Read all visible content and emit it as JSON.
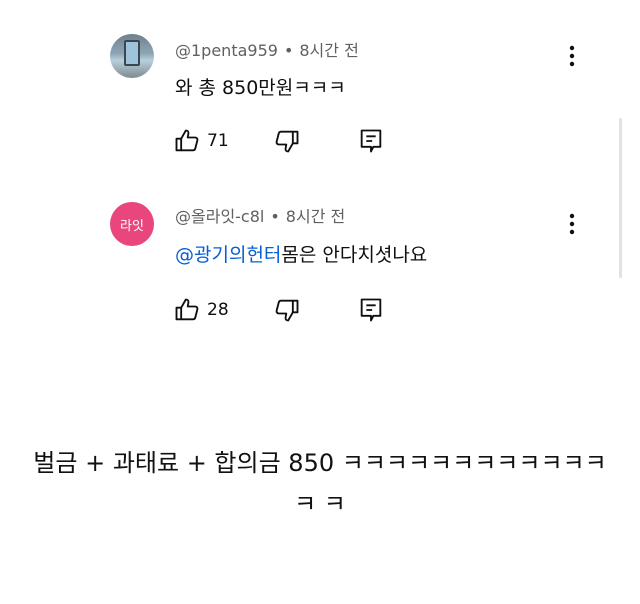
{
  "comments": [
    {
      "author": "@1penta959",
      "time": "8시간 전",
      "text": "와 총 850만원ㅋㅋㅋ",
      "likes": "71",
      "avatar_icon": "window-photo"
    },
    {
      "author": "@올라잇-c8l",
      "time": "8시간 전",
      "mention": "@광기의헌터",
      "text": "몸은 안다치셧나요",
      "likes": "28",
      "avatar_text": "라잇",
      "avatar_color": "#e8467c"
    }
  ],
  "separator": "•",
  "caption": "벌금 + 과태료 + 합의금 850 ㅋㅋㅋㅋㅋㅋㅋㅋㅋㅋㅋㅋㅋ ㅋ",
  "icons": [
    "thumbs-up-icon",
    "thumbs-down-icon",
    "reply-icon",
    "more-vertical-icon"
  ],
  "colors": {
    "mention": "#065fd4",
    "meta": "#606060"
  }
}
